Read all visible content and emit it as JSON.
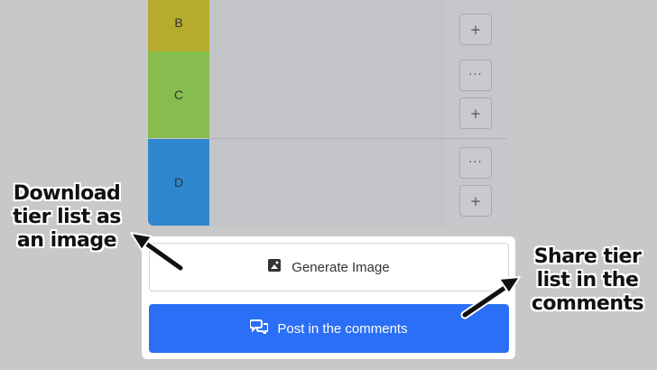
{
  "tiers": [
    {
      "label": "B",
      "color": "#b5ab2e"
    },
    {
      "label": "C",
      "color": "#87bd4e"
    },
    {
      "label": "D",
      "color": "#2f87cf"
    }
  ],
  "controls": {
    "more_symbol": "···",
    "add_symbol": "+"
  },
  "actions": {
    "generate_label": "Generate Image",
    "generate_icon": "image-icon",
    "post_label": "Post in the comments",
    "post_icon": "comments-icon",
    "post_color": "#2a6ff5"
  },
  "annotations": {
    "left": [
      "Download",
      "tier list as",
      "an image"
    ],
    "right": [
      "Share tier",
      "list in the",
      "comments"
    ]
  }
}
